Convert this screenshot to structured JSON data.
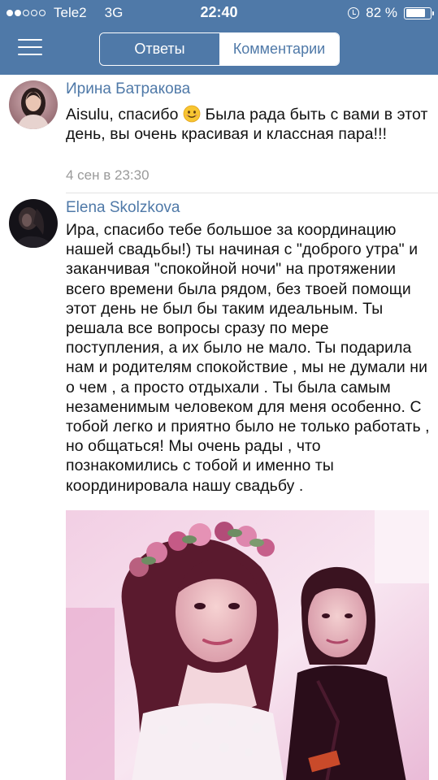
{
  "status_bar": {
    "carrier": "Tele2",
    "network": "3G",
    "time": "22:40",
    "battery_percent": "82 %",
    "battery_level": 0.82,
    "signal_bars_filled": 2,
    "signal_bars_total": 5
  },
  "nav": {
    "tabs": [
      {
        "label": "Ответы",
        "active": false
      },
      {
        "label": "Комментарии",
        "active": true
      }
    ]
  },
  "comments": [
    {
      "author": "Ирина Батракова",
      "text_before_emoji": "Aisulu, спасибо ",
      "emoji": "smiling-face",
      "text_after_emoji": " Была рада быть с вами в этот день, вы очень красивая и классная пара!!!",
      "date": "4 сен в 23:30"
    },
    {
      "author": "Elena Skolzkova",
      "text": "Ира, спасибо тебе большое за координацию нашей свадьбы!) ты начиная с \"доброго утра\" и заканчивая \"спокойной ночи\" на протяжении всего времени была рядом, без твоей помощи этот день не был бы таким идеальным. Ты решала все вопросы сразу по мере поступления, а их было не мало. Ты подарила нам и родителям спокойствие , мы не думали ни о чем , а просто отдыхали . Ты была самым незаменимым человеком для меня особенно. С тобой легко и приятно было не только работать , но общаться! Мы очень рады , что познакомились с тобой и именно ты координировала нашу свадьбу ."
    }
  ],
  "colors": {
    "header": "#4f79a8",
    "link": "#4f79a8",
    "date": "#9a9a9a"
  }
}
